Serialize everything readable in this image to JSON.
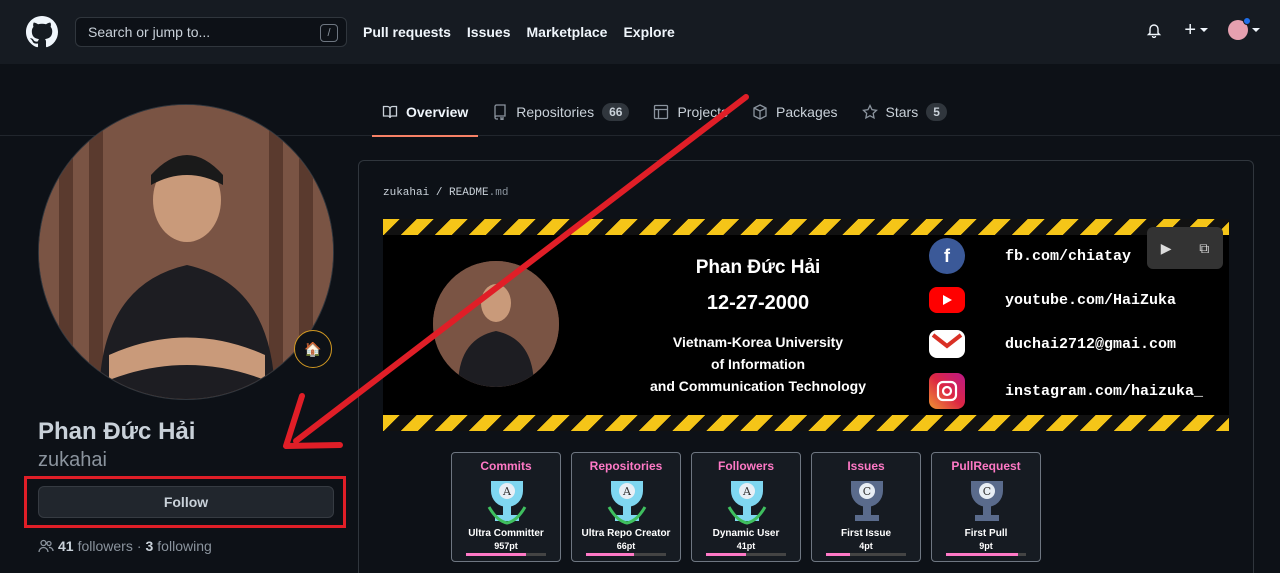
{
  "header": {
    "search_placeholder": "Search or jump to...",
    "search_key": "/",
    "nav": [
      "Pull requests",
      "Issues",
      "Marketplace",
      "Explore"
    ]
  },
  "tabs": [
    {
      "label": "Overview",
      "icon": "book-icon",
      "active": true
    },
    {
      "label": "Repositories",
      "icon": "repo-icon",
      "count": "66"
    },
    {
      "label": "Projects",
      "icon": "project-icon"
    },
    {
      "label": "Packages",
      "icon": "package-icon"
    },
    {
      "label": "Stars",
      "icon": "star-icon",
      "count": "5"
    }
  ],
  "profile": {
    "name": "Phan Đức Hải",
    "username": "zukahai",
    "follow_label": "Follow",
    "followers": "41",
    "followers_label": "followers",
    "separator": "·",
    "following": "3",
    "following_label": "following",
    "status_emoji": "🏠"
  },
  "readme": {
    "owner": "zukahai",
    "file": "README",
    "ext": ".md",
    "banner": {
      "name": "Phan Đức Hải",
      "date": "12-27-2000",
      "uni_line1": "Vietnam-Korea University",
      "uni_line2": "of Information",
      "uni_line3": "and Communication Technology",
      "contacts": [
        {
          "icon": "facebook-icon",
          "text": "fb.com/chiatay",
          "color": "#3b5998"
        },
        {
          "icon": "youtube-icon",
          "text": "youtube.com/HaiZuka",
          "color": "#ff0000"
        },
        {
          "icon": "gmail-icon",
          "text": "duchai2712@gmai.com",
          "color": "#ffffff"
        },
        {
          "icon": "instagram-icon",
          "text": "instagram.com/haizuka_",
          "color": "#c13584"
        }
      ]
    }
  },
  "trophies": [
    {
      "title": "Commits",
      "rank": "A",
      "name": "Ultra Committer",
      "points": "957pt",
      "progress": 0.75,
      "tier": "gold"
    },
    {
      "title": "Repositories",
      "rank": "A",
      "name": "Ultra Repo Creator",
      "points": "66pt",
      "progress": 0.6,
      "tier": "gold"
    },
    {
      "title": "Followers",
      "rank": "A",
      "name": "Dynamic User",
      "points": "41pt",
      "progress": 0.5,
      "tier": "gold"
    },
    {
      "title": "Issues",
      "rank": "C",
      "name": "First Issue",
      "points": "4pt",
      "progress": 0.3,
      "tier": "bronze"
    },
    {
      "title": "PullRequest",
      "rank": "C",
      "name": "First Pull",
      "points": "9pt",
      "progress": 0.9,
      "tier": "bronze"
    }
  ]
}
